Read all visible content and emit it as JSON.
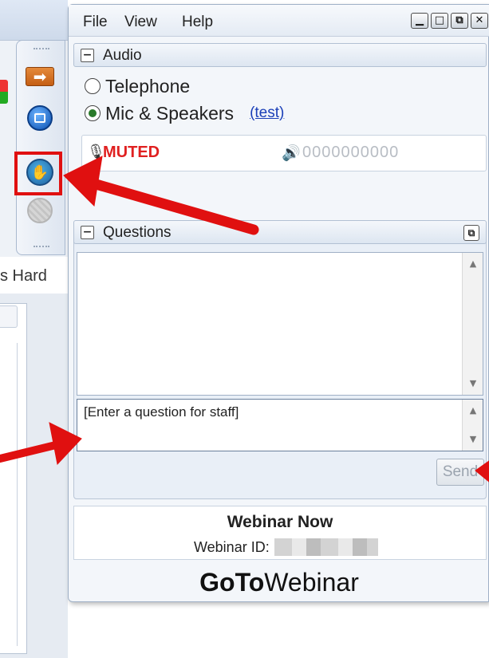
{
  "menubar": {
    "file": "File",
    "view": "View",
    "help": "Help",
    "window_buttons": [
      "▁",
      "□",
      "⧉",
      "✕"
    ]
  },
  "background": {
    "document_title": "s Hard"
  },
  "toolbar": {
    "icons": [
      "arrow-right-icon",
      "screen-share-icon",
      "raise-hand-icon",
      "disabled-icon"
    ]
  },
  "audio": {
    "section_title": "Audio",
    "collapse_symbol": "−",
    "options": [
      {
        "label": "Telephone",
        "selected": false
      },
      {
        "label": "Mic & Speakers",
        "selected": true
      }
    ],
    "test_link": "(test)",
    "mic_status": "MUTED",
    "level_meter": "0000000000",
    "status_color": "#e02020"
  },
  "questions": {
    "section_title": "Questions",
    "collapse_symbol": "−",
    "input_value": "[Enter a question for staff]",
    "send_label": "Send"
  },
  "webinar": {
    "title": "Webinar Now",
    "id_label": "Webinar ID:"
  },
  "logo": {
    "part1": "GoTo",
    "part2": "Webinar"
  },
  "annotation_color": "#e01010"
}
